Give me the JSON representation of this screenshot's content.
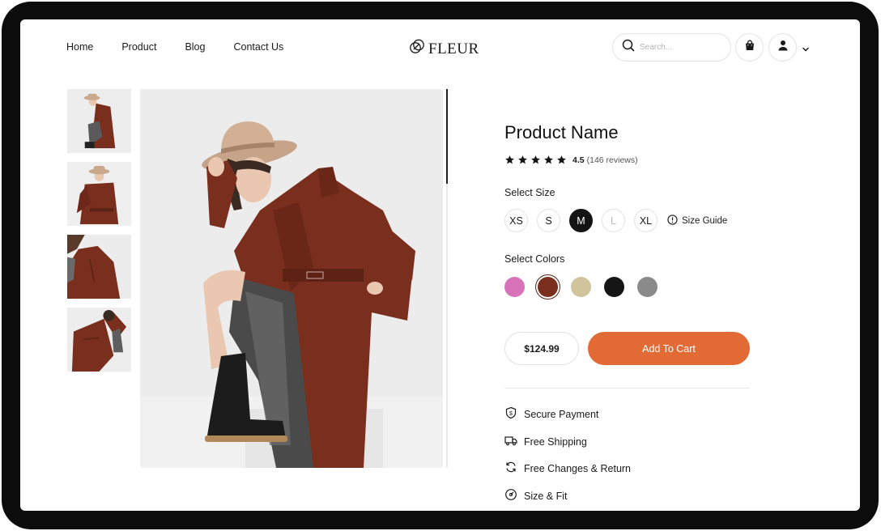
{
  "nav": {
    "links": [
      "Home",
      "Product",
      "Blog",
      "Contact Us"
    ],
    "logo_text": "FLEUR",
    "search_placeholder": "Search...",
    "icons": [
      "search-icon",
      "shopping-bag-icon",
      "user-icon",
      "chevron-down-icon"
    ]
  },
  "gallery": {
    "thumbnails": [
      "thumbnail-1",
      "thumbnail-2",
      "thumbnail-3",
      "thumbnail-4"
    ],
    "selected_index": 0
  },
  "product": {
    "name": "Product Name",
    "rating": "4.5",
    "reviews": "(146 reviews)",
    "star_count": 5,
    "size_label": "Select Size",
    "sizes": [
      {
        "label": "XS",
        "state": "default"
      },
      {
        "label": "S",
        "state": "default"
      },
      {
        "label": "M",
        "state": "selected"
      },
      {
        "label": "L",
        "state": "disabled"
      },
      {
        "label": "XL",
        "state": "default"
      }
    ],
    "size_guide": "Size Guide",
    "color_label": "Select Colors",
    "colors": [
      "#d873b9",
      "#7a2e1d",
      "#d1c39b",
      "#151515",
      "#8a8a8a"
    ],
    "selected_color_index": 1,
    "price": "$124.99",
    "add_to_cart": "Add To Cart",
    "features": [
      {
        "icon": "shield-dollar-icon",
        "label": "Secure Payment"
      },
      {
        "icon": "truck-icon",
        "label": "Free Shipping"
      },
      {
        "icon": "refresh-icon",
        "label": "Free Changes & Return"
      },
      {
        "icon": "ruler-dial-icon",
        "label": "Size & Fit"
      }
    ]
  },
  "colors": {
    "frame": "#0c0c0c",
    "accent": "#e26a35",
    "coat": "#7a2e1d",
    "text": "#1a1a1a"
  }
}
